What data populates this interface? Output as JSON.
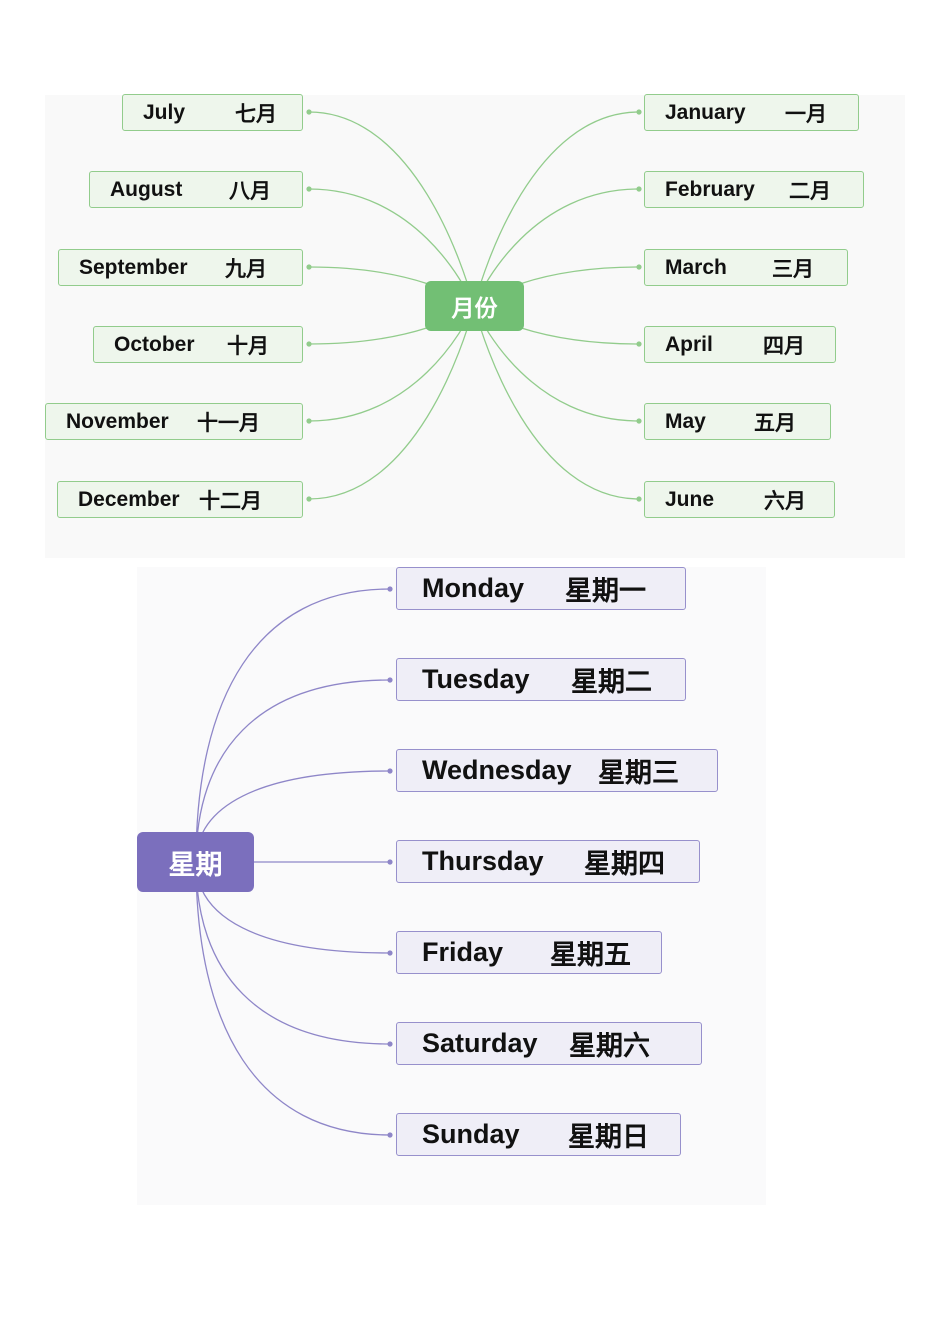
{
  "colors": {
    "month_accent": "#72bf74",
    "month_line": "#92cc8c",
    "month_node_bg": "#eef6ec",
    "week_accent": "#7b6fbd",
    "week_line": "#8e86c8",
    "week_node_bg": "#efeef7"
  },
  "months_map": {
    "root": "月份",
    "left": [
      {
        "en": "July",
        "zh": "七月"
      },
      {
        "en": "August",
        "zh": "八月"
      },
      {
        "en": "September",
        "zh": "九月"
      },
      {
        "en": "October",
        "zh": "十月"
      },
      {
        "en": "November",
        "zh": "十一月"
      },
      {
        "en": "December",
        "zh": "十二月"
      }
    ],
    "right": [
      {
        "en": "January",
        "zh": "一月"
      },
      {
        "en": "February",
        "zh": "二月"
      },
      {
        "en": "March",
        "zh": "三月"
      },
      {
        "en": "April",
        "zh": "四月"
      },
      {
        "en": "May",
        "zh": "五月"
      },
      {
        "en": "June",
        "zh": "六月"
      }
    ]
  },
  "weeks_map": {
    "root": "星期",
    "items": [
      {
        "en": "Monday",
        "zh": "星期一"
      },
      {
        "en": "Tuesday",
        "zh": "星期二"
      },
      {
        "en": "Wednesday",
        "zh": "星期三"
      },
      {
        "en": "Thursday",
        "zh": "星期四"
      },
      {
        "en": "Friday",
        "zh": "星期五"
      },
      {
        "en": "Saturday",
        "zh": "星期六"
      },
      {
        "en": "Sunday",
        "zh": "星期日"
      }
    ]
  }
}
